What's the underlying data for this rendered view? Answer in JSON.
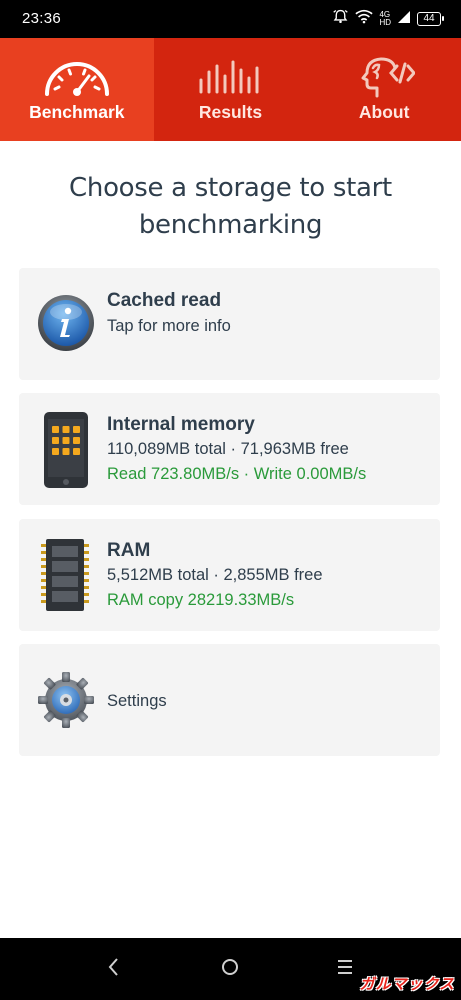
{
  "status_bar": {
    "time": "23:36",
    "network": "4G",
    "hd": "HD",
    "battery": "44"
  },
  "tabs": [
    {
      "label": "Benchmark",
      "icon": "speedometer-icon",
      "active": true
    },
    {
      "label": "Results",
      "icon": "bars-icon",
      "active": false
    },
    {
      "label": "About",
      "icon": "head-code-icon",
      "active": false
    }
  ],
  "heading": "Choose a storage to start benchmarking",
  "cards": {
    "cached_read": {
      "icon": "info-icon",
      "title": "Cached read",
      "subtitle": "Tap for more info"
    },
    "internal_memory": {
      "icon": "phone-icon",
      "title": "Internal memory",
      "capacity": "110,089MB total · 71,963MB free",
      "speed": "Read 723.80MB/s · Write 0.00MB/s"
    },
    "ram": {
      "icon": "ram-chip-icon",
      "title": "RAM",
      "capacity": "5,512MB total · 2,855MB free",
      "speed": "RAM copy 28219.33MB/s"
    },
    "settings": {
      "icon": "gear-icon",
      "label": "Settings"
    }
  },
  "colors": {
    "tab_bar": "#d3250f",
    "tab_active": "#e84020",
    "speed_text": "#2a9a3a",
    "card_bg": "#f4f4f4",
    "text_dark": "#2f3e4c"
  },
  "watermark": "ガルマックス"
}
